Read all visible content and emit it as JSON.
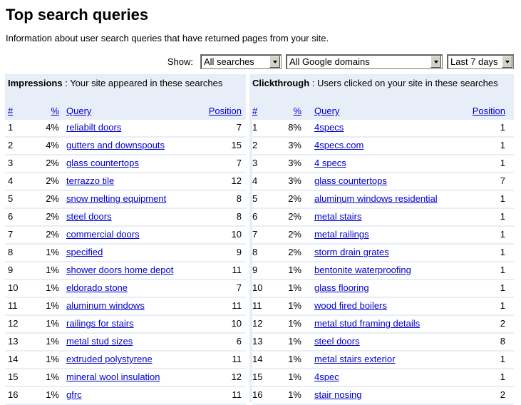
{
  "page": {
    "title": "Top search queries",
    "description": "Information about user search queries that have returned pages from your site."
  },
  "filters": {
    "show_label": "Show:",
    "search_type": "All searches",
    "domain": "All Google domains",
    "period": "Last 7 days"
  },
  "impressions": {
    "heading_bold": "Impressions",
    "heading_text": " : Your site appeared in these searches",
    "columns": {
      "num": "#",
      "pct": "%",
      "query": "Query",
      "position": "Position"
    },
    "rows": [
      {
        "num": "1",
        "pct": "4%",
        "query": "reliabilt doors",
        "position": "7"
      },
      {
        "num": "2",
        "pct": "4%",
        "query": "gutters and downspouts",
        "position": "15"
      },
      {
        "num": "3",
        "pct": "2%",
        "query": "glass countertops",
        "position": "7"
      },
      {
        "num": "4",
        "pct": "2%",
        "query": "terrazzo tile",
        "position": "12"
      },
      {
        "num": "5",
        "pct": "2%",
        "query": "snow melting equipment",
        "position": "8"
      },
      {
        "num": "6",
        "pct": "2%",
        "query": "steel doors",
        "position": "8"
      },
      {
        "num": "7",
        "pct": "2%",
        "query": "commercial doors",
        "position": "10"
      },
      {
        "num": "8",
        "pct": "1%",
        "query": "specified",
        "position": "9"
      },
      {
        "num": "9",
        "pct": "1%",
        "query": "shower doors home depot",
        "position": "11"
      },
      {
        "num": "10",
        "pct": "1%",
        "query": "eldorado stone",
        "position": "7"
      },
      {
        "num": "11",
        "pct": "1%",
        "query": "aluminum windows",
        "position": "11"
      },
      {
        "num": "12",
        "pct": "1%",
        "query": "railings for stairs",
        "position": "10"
      },
      {
        "num": "13",
        "pct": "1%",
        "query": "metal stud sizes",
        "position": "6"
      },
      {
        "num": "14",
        "pct": "1%",
        "query": "extruded polystyrene",
        "position": "11"
      },
      {
        "num": "15",
        "pct": "1%",
        "query": "mineral wool insulation",
        "position": "12"
      },
      {
        "num": "16",
        "pct": "1%",
        "query": "gfrc",
        "position": "11"
      }
    ]
  },
  "clickthrough": {
    "heading_bold": "Clickthrough",
    "heading_text": " : Users clicked on your site in these searches",
    "columns": {
      "num": "#",
      "pct": "%",
      "query": "Query",
      "position": "Position"
    },
    "rows": [
      {
        "num": "1",
        "pct": "8%",
        "query": "4specs",
        "position": "1"
      },
      {
        "num": "2",
        "pct": "3%",
        "query": "4specs.com",
        "position": "1"
      },
      {
        "num": "3",
        "pct": "3%",
        "query": "4 specs",
        "position": "1"
      },
      {
        "num": "4",
        "pct": "3%",
        "query": "glass countertops",
        "position": "7"
      },
      {
        "num": "5",
        "pct": "2%",
        "query": "aluminum windows residential",
        "position": "1"
      },
      {
        "num": "6",
        "pct": "2%",
        "query": "metal stairs",
        "position": "1"
      },
      {
        "num": "7",
        "pct": "2%",
        "query": "metal railings",
        "position": "1"
      },
      {
        "num": "8",
        "pct": "2%",
        "query": "storm drain grates",
        "position": "1"
      },
      {
        "num": "9",
        "pct": "1%",
        "query": "bentonite waterproofing",
        "position": "1"
      },
      {
        "num": "10",
        "pct": "1%",
        "query": "glass flooring",
        "position": "1"
      },
      {
        "num": "11",
        "pct": "1%",
        "query": "wood fired boilers",
        "position": "1"
      },
      {
        "num": "12",
        "pct": "1%",
        "query": "metal stud framing details",
        "position": "2"
      },
      {
        "num": "13",
        "pct": "1%",
        "query": "steel doors",
        "position": "8"
      },
      {
        "num": "14",
        "pct": "1%",
        "query": "metal stairs exterior",
        "position": "1"
      },
      {
        "num": "15",
        "pct": "1%",
        "query": "4spec",
        "position": "1"
      },
      {
        "num": "16",
        "pct": "1%",
        "query": "stair nosing",
        "position": "2"
      }
    ]
  }
}
